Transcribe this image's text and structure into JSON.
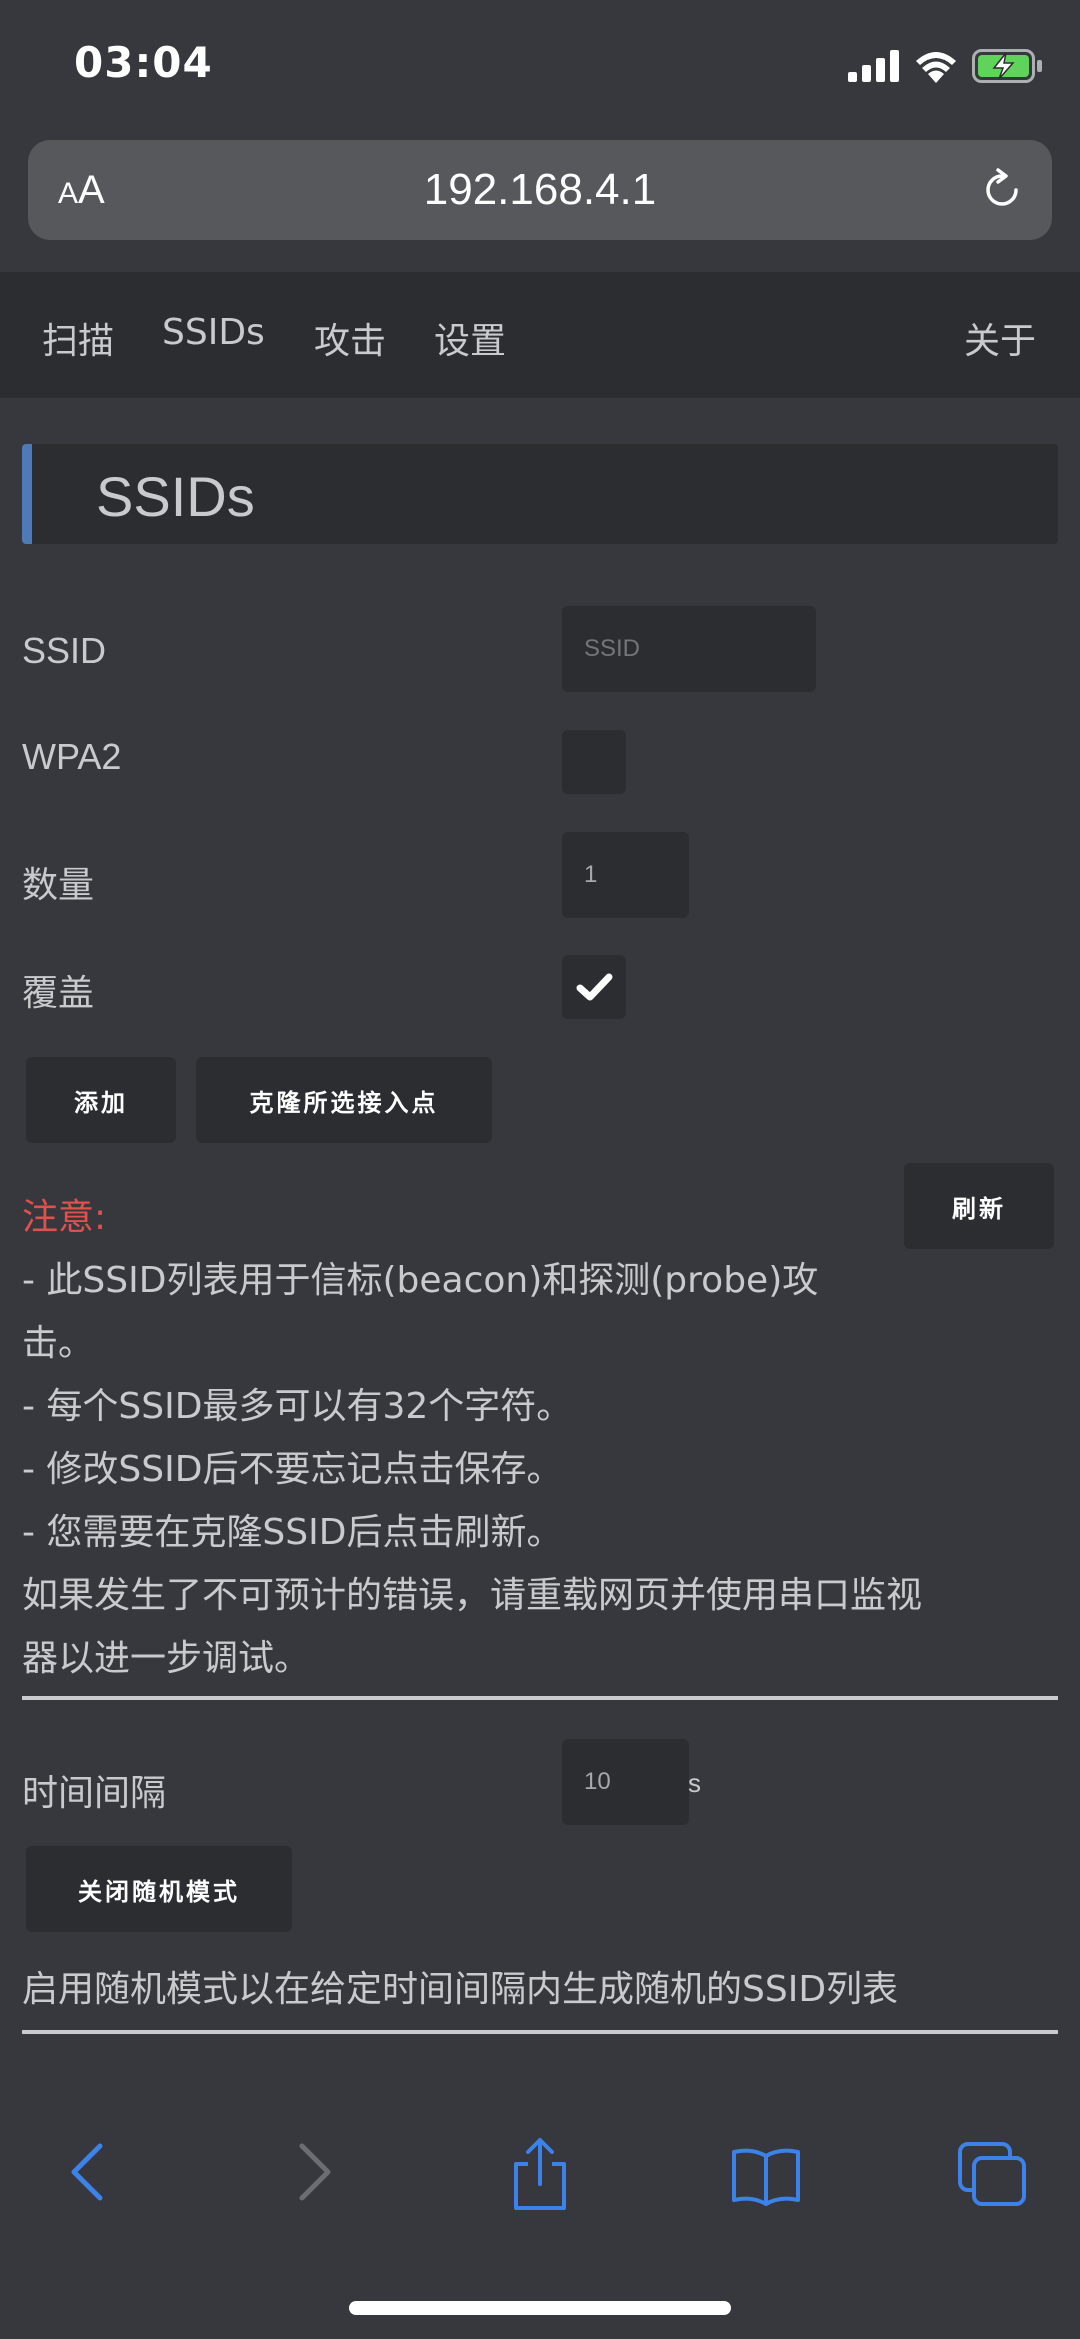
{
  "status_bar": {
    "time": "03:04"
  },
  "browser": {
    "text_size_button": "AA",
    "url": "192.168.4.1"
  },
  "nav": {
    "items": [
      "扫描",
      "SSIDs",
      "攻击",
      "设置"
    ],
    "about": "关于"
  },
  "page": {
    "title": "SSIDs"
  },
  "form": {
    "ssid_label": "SSID",
    "ssid_placeholder": "SSID",
    "wpa2_label": "WPA2",
    "wpa2_checked": false,
    "count_label": "数量",
    "count_value": "1",
    "overwrite_label": "覆盖",
    "overwrite_checked": true,
    "add_button": "添加",
    "clone_button": "克隆所选接入点",
    "refresh_button": "刷新"
  },
  "notes": {
    "title": "注意:",
    "lines": [
      "- 此SSID列表用于信标(beacon)和探测(probe)攻",
      "击。",
      "- 每个SSID最多可以有32个字符。",
      "- 修改SSID后不要忘记点击保存。",
      "- 您需要在克隆SSID后点击刷新。",
      "如果发生了不可预计的错误，请重载网页并使用串口监视",
      "器以进一步调试。"
    ]
  },
  "random": {
    "interval_label": "时间间隔",
    "interval_value": "10",
    "interval_unit": "s",
    "toggle_button": "关闭随机模式",
    "description": "启用随机模式以在给定时间间隔内生成随机的SSID列表"
  },
  "colors": {
    "accent": "#4f7ab8",
    "warning": "#e0504d",
    "toolbar_icon": "#3d82e8"
  }
}
